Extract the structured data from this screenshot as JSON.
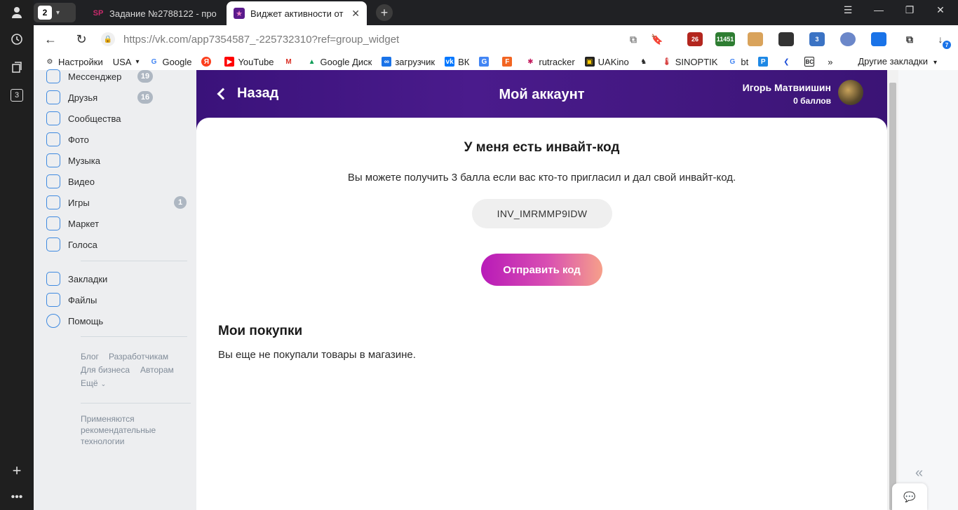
{
  "browser": {
    "tab_group_count": "2",
    "tabs": [
      {
        "label": "Задание №2788122 - про",
        "favicon": "SP"
      },
      {
        "label": "Виджет активности от L",
        "favicon": "★"
      }
    ],
    "url": "https://vk.com/app7354587_-225732310?ref=group_widget",
    "extension_badges": [
      "26",
      "11451",
      "3",
      "7"
    ],
    "strip_badge": "3"
  },
  "bookmarks": {
    "items": [
      "Настройки",
      "USA",
      "Google",
      "YouTube",
      "Google Диск",
      "загрузчик",
      "ВК",
      "rutracker",
      "UAKino",
      "SINOPTIK",
      "bt"
    ],
    "more": "»",
    "other": "Другие закладки"
  },
  "vk_sidebar": {
    "items": [
      {
        "label": "Мессенджер",
        "badge": "19"
      },
      {
        "label": "Друзья",
        "badge": "16"
      },
      {
        "label": "Сообщества",
        "badge": ""
      },
      {
        "label": "Фото",
        "badge": ""
      },
      {
        "label": "Музыка",
        "badge": ""
      },
      {
        "label": "Видео",
        "badge": ""
      },
      {
        "label": "Игры",
        "badge": "1"
      },
      {
        "label": "Маркет",
        "badge": ""
      },
      {
        "label": "Голоса",
        "badge": ""
      }
    ],
    "secondary": [
      "Закладки",
      "Файлы",
      "Помощь"
    ],
    "footer_links": [
      "Блог",
      "Разработчикам",
      "Для бизнеса",
      "Авторам",
      "Ещё"
    ],
    "footer_note_lines": [
      "Применяются",
      "рекомендательные",
      "технологии"
    ]
  },
  "app": {
    "back_label": "Назад",
    "title": "Мой аккаунт",
    "user_name": "Игорь Матвиишин",
    "user_points": "0 баллов",
    "invite_title": "У меня есть инвайт-код",
    "invite_desc": "Вы можете получить 3 балла если вас кто-то пригласил и дал свой инвайт-код.",
    "invite_code": "INV_IMRMMP9IDW",
    "send_button": "Отправить код",
    "purchases_title": "Мои покупки",
    "purchases_empty": "Вы еще не покупали товары в магазине."
  }
}
